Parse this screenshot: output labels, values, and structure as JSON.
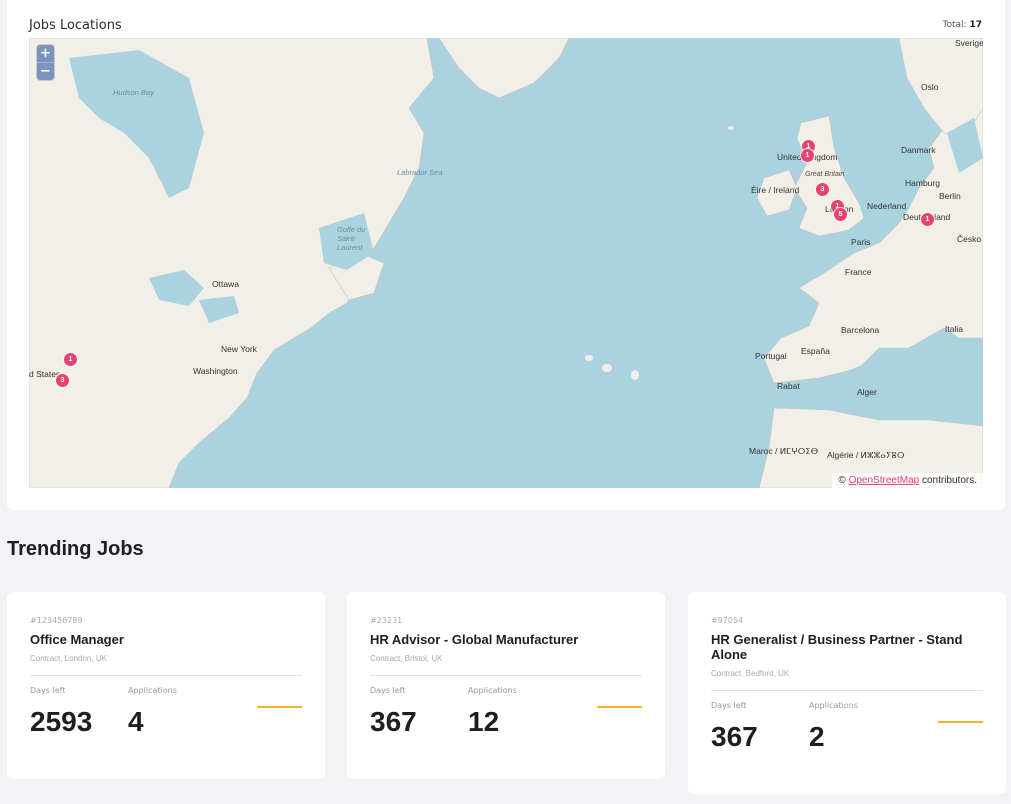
{
  "map": {
    "title": "Jobs Locations",
    "total_label": "Total:",
    "total_value": "17",
    "zoom_in": "+",
    "zoom_out": "−",
    "attribution_prefix": "©",
    "attribution_link": "OpenStreetMap",
    "attribution_suffix": "contributors.",
    "labels": {
      "hudson": "Hudson Bay",
      "labrador": "Labrador Sea",
      "ottawa": "Ottawa",
      "newyork": "New York",
      "washington": "Washington",
      "states": "d States",
      "sverige": "Sverige",
      "oslo": "Oslo",
      "uk": "United Kingdom",
      "gb": "Great Britain",
      "eire": "Éire / Ireland",
      "danmark": "Danmark",
      "hamburg": "Hamburg",
      "berlin": "Berlin",
      "nederland": "Nederland",
      "london": "London",
      "deutschland": "Deutschland",
      "paris": "Paris",
      "cesko": "Česko",
      "france": "France",
      "barcelona": "Barcelona",
      "italia": "Italia",
      "portugal": "Portugal",
      "espana": "España",
      "rabat": "Rabat",
      "alger": "Alger",
      "maroc": "Maroc / ⵍⵎⵖⵔⵉⴱ",
      "algerie": "Algérie / ⵍⵣⵣⴰⵢⴻⵔ",
      "gulf": "Golfe du Saint-Laurent"
    },
    "markers": [
      {
        "count": "1"
      },
      {
        "count": "1"
      },
      {
        "count": "3"
      },
      {
        "count": "1"
      },
      {
        "count": "5"
      },
      {
        "count": "1"
      },
      {
        "count": "1"
      },
      {
        "count": "3"
      }
    ]
  },
  "trending": {
    "title": "Trending Jobs",
    "days_label": "Days left",
    "apps_label": "Applications",
    "jobs": [
      {
        "id": "#123456789",
        "title": "Office Manager",
        "meta": "Contract, London, UK",
        "days_left": "2593",
        "applications": "4"
      },
      {
        "id": "#23231",
        "title": "HR Advisor - Global Manufacturer",
        "meta": "Contract, Bristol, UK",
        "days_left": "367",
        "applications": "12"
      },
      {
        "id": "#97054",
        "title": "HR Generalist / Business Partner - Stand Alone",
        "meta": "Contract, Bedford, UK",
        "days_left": "367",
        "applications": "2"
      }
    ]
  },
  "colors": {
    "marker": "#e8426e",
    "accent": "#f5b324",
    "water": "#aad3df",
    "land": "#f2efe9"
  }
}
